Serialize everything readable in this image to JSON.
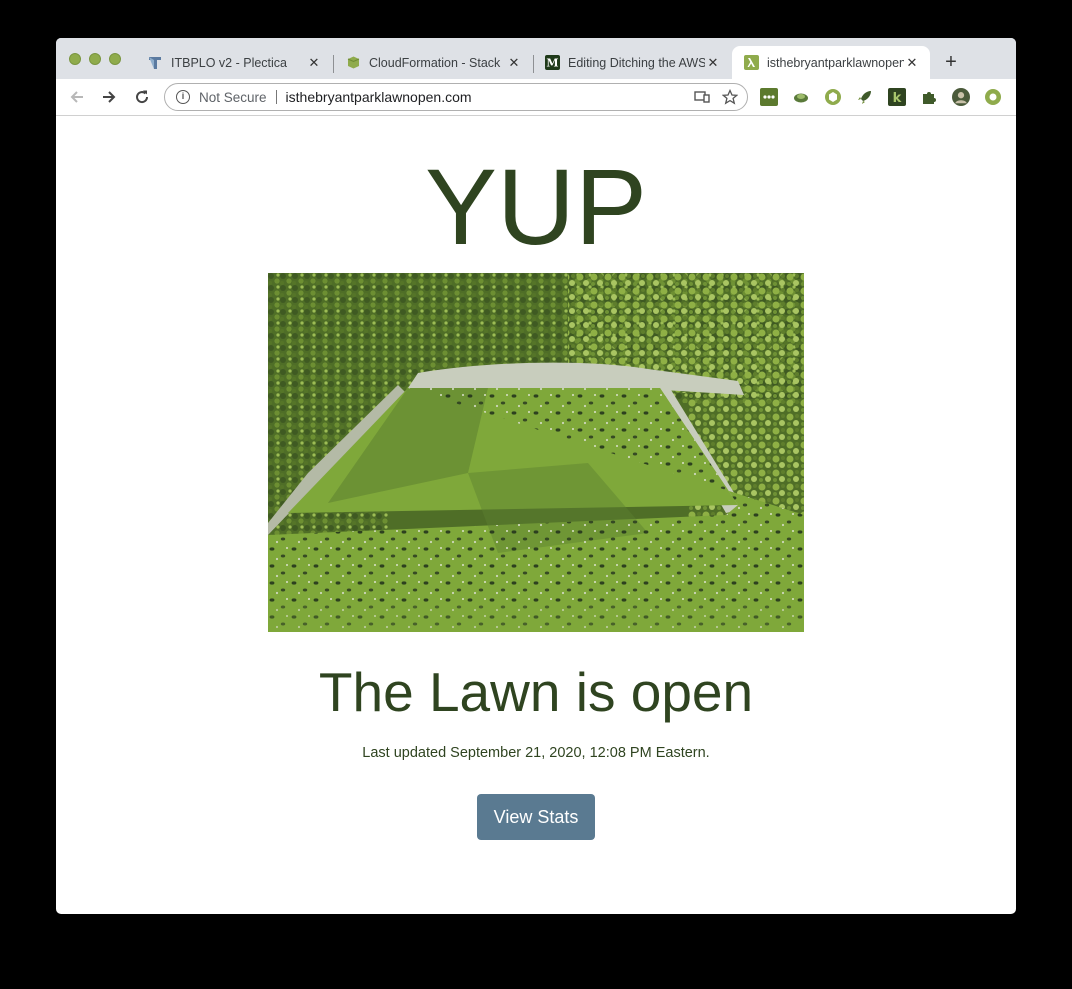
{
  "browser": {
    "tabs": [
      {
        "title": "ITBPLO v2 - Plectica",
        "favicon": "plectica-icon",
        "close": "✕"
      },
      {
        "title": "CloudFormation - Stack",
        "favicon": "cloudformation-icon",
        "close": "✕"
      },
      {
        "title": "Editing Ditching the AWS",
        "favicon": "medium-icon",
        "close": "✕"
      },
      {
        "title": "isthebryantparklawnopen",
        "favicon": "lambda-icon",
        "close": "✕"
      }
    ],
    "new_tab": "+",
    "address": {
      "security_label": "Not Secure",
      "url": "isthebryantparklawnopen.com"
    },
    "extensions": [
      "ext-grid-icon",
      "ext-turtle-icon",
      "ext-hex-icon",
      "ext-rocket-icon",
      "ext-k-icon",
      "puzzle-icon",
      "profile-avatar",
      "ext-circle-icon"
    ]
  },
  "page": {
    "headline": "YUP",
    "status": "The Lawn is open",
    "updated": "Last updated September 21, 2020, 12:08 PM Eastern.",
    "button": "View Stats"
  },
  "colors": {
    "text_green": "#2f4420",
    "button": "#5a7a91",
    "lawn": "#7fa83a",
    "chrome_bg": "#dee1e6"
  }
}
